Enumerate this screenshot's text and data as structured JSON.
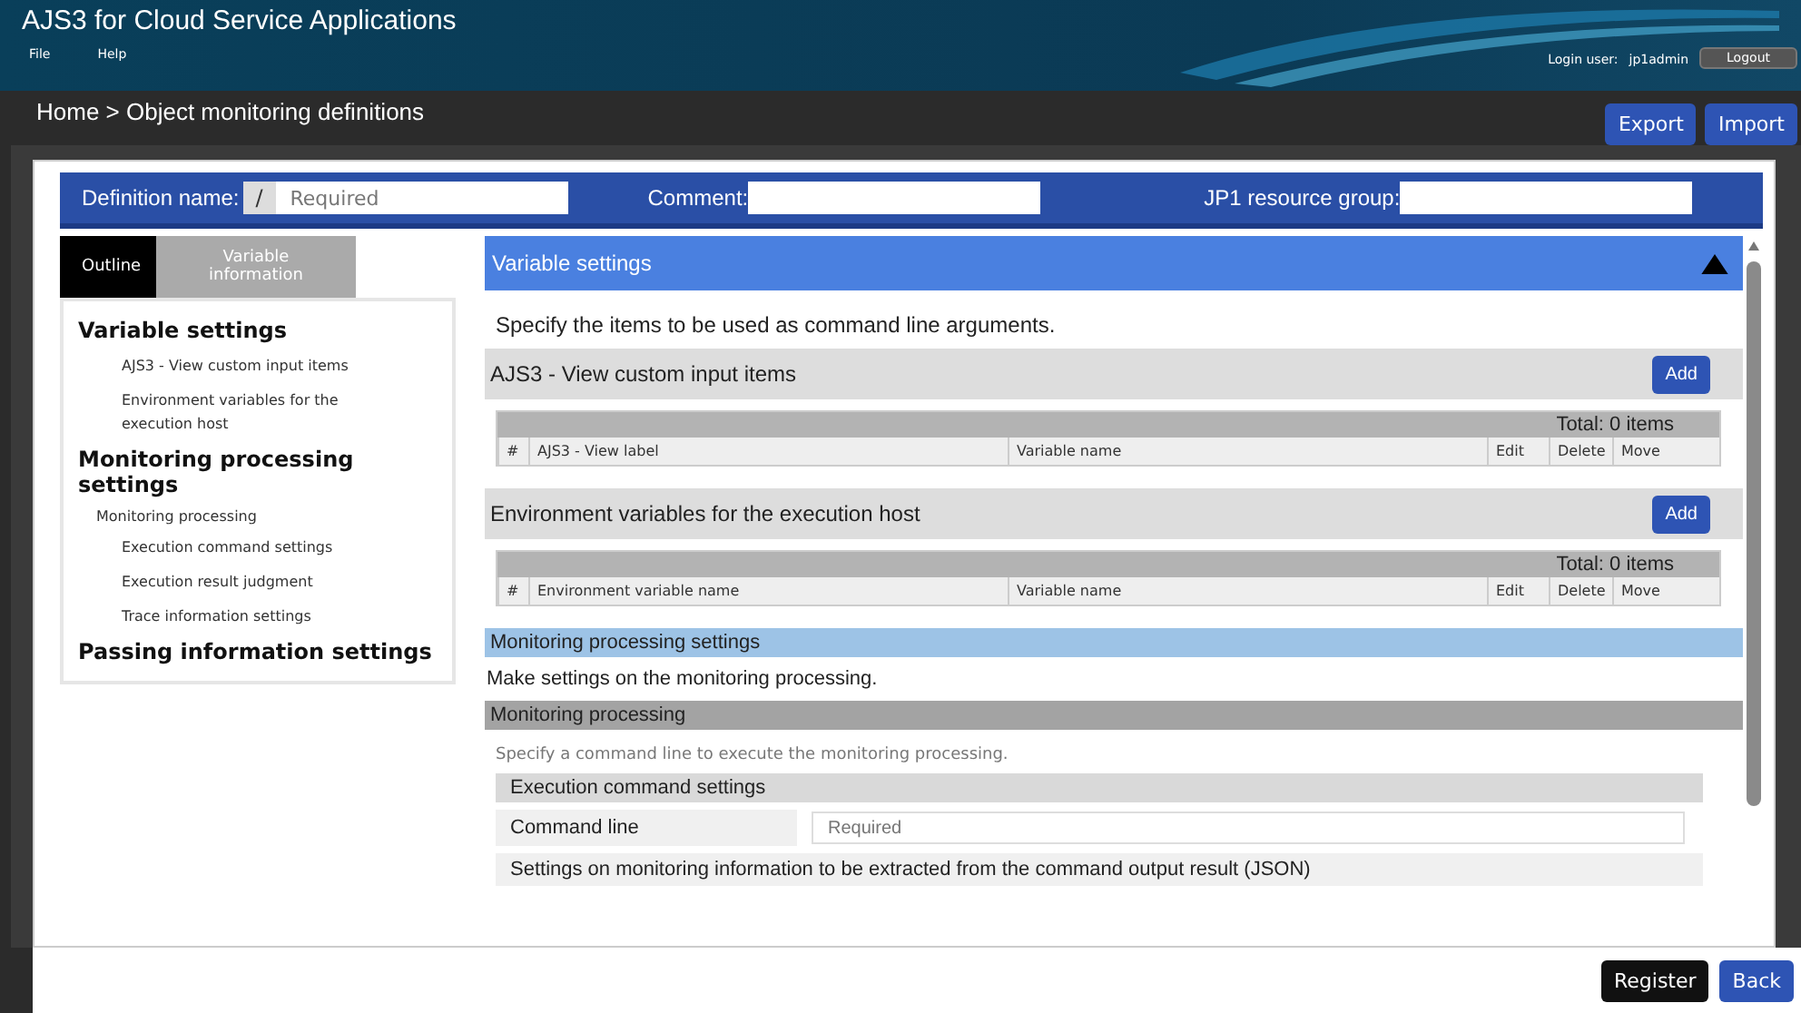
{
  "header": {
    "title": "AJS3 for Cloud Service Applications",
    "menu": [
      "File",
      "Help"
    ],
    "login_label": "Login user:",
    "user": "jp1admin",
    "logout": "Logout"
  },
  "breadcrumb": "Home > Object monitoring definitions",
  "toolbar": [
    "Export",
    "Import"
  ],
  "form_bar": {
    "definition_label": "Definition name:",
    "prefix": "/",
    "definition_placeholder": "Required",
    "comment_label": "Comment:",
    "group_label": "JP1 resource group:"
  },
  "sidebar": {
    "tabs": [
      {
        "label": "Outline",
        "selected": true
      },
      {
        "label": "Variable information",
        "selected": false
      }
    ],
    "outline": [
      {
        "label": "Variable settings",
        "children": [
          {
            "label": "AJS3 - View custom input items"
          },
          {
            "label": "Environment variables for the execution host"
          }
        ]
      },
      {
        "label": "Monitoring processing settings",
        "children": [
          {
            "label": "Monitoring processing",
            "children": [
              {
                "label": "Execution command settings"
              },
              {
                "label": "Execution result judgment"
              },
              {
                "label": "Trace information settings"
              }
            ]
          }
        ]
      },
      {
        "label": "Passing information settings"
      }
    ]
  },
  "variable_section": {
    "title": "Variable settings",
    "expanded": true,
    "description": "Specify the items to be used as command line arguments.",
    "tables": [
      {
        "title": "AJS3 - View custom input items",
        "add": "Add",
        "total": "Total: 0 items",
        "columns": [
          "#",
          "AJS3 - View label",
          "Variable name",
          "Edit",
          "Delete",
          "Move"
        ]
      },
      {
        "title": "Environment variables for the execution host",
        "add": "Add",
        "total": "Total: 0 items",
        "columns": [
          "#",
          "Environment variable name",
          "Variable name",
          "Edit",
          "Delete",
          "Move"
        ]
      }
    ]
  },
  "monitoring_section": {
    "title": "Monitoring processing settings",
    "description": "Make settings on the monitoring processing.",
    "group": "Monitoring processing",
    "hint": "Specify a command line to execute the monitoring processing.",
    "subgroup": "Execution command settings",
    "field_label": "Command line",
    "field_placeholder": "Required",
    "next_row": "Settings on monitoring information to be extracted from the command output result (JSON)"
  },
  "footer": [
    "Register",
    "Back"
  ]
}
